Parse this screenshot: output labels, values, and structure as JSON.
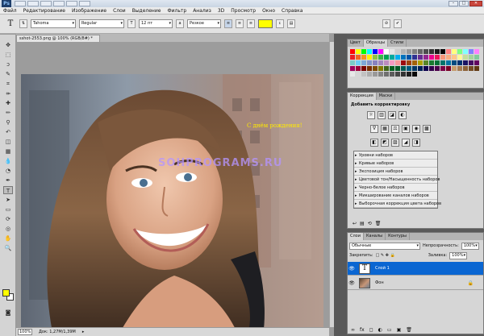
{
  "app": {
    "logo": "Ps"
  },
  "menu": [
    "Файл",
    "Редактирование",
    "Изображение",
    "Слои",
    "Выделение",
    "Фильтр",
    "Анализ",
    "3D",
    "Просмотр",
    "Окно",
    "Справка"
  ],
  "window_controls": {
    "minimize": "–",
    "maximize": "□",
    "close": "✕"
  },
  "options": {
    "tool_glyph": "T",
    "font_family": "Tahoma",
    "font_style": "Regular",
    "font_size": "12 пт",
    "antialias": "Резкое",
    "text_color": "#ffff00",
    "cancel_glyph": "⊘",
    "commit_glyph": "✔"
  },
  "document": {
    "tab": "sshot-2553.png @ 100% (RGB/8#) *",
    "overlay_text": "С днём рождения!",
    "watermark": "SOHPROGRAMS.RU"
  },
  "status": {
    "zoom": "100%",
    "doc": "Док: 1,27M/1,39M"
  },
  "swatches_panel": {
    "tabs": [
      "Цвет",
      "Образцы",
      "Стили"
    ],
    "active_tab": 1,
    "colors": [
      "#ff0000",
      "#ffff00",
      "#00ff00",
      "#00ffff",
      "#0000ff",
      "#ff00ff",
      "#ffffff",
      "#e6e6e6",
      "#cccccc",
      "#b3b3b3",
      "#999999",
      "#808080",
      "#666666",
      "#4d4d4d",
      "#333333",
      "#1a1a1a",
      "#000000",
      "#ff8080",
      "#ffff80",
      "#80ff80",
      "#80ffff",
      "#8080ff",
      "#ff80ff",
      "#ed1c24",
      "#f26522",
      "#f7941d",
      "#fff200",
      "#8dc63f",
      "#39b54a",
      "#00a651",
      "#00a99d",
      "#00aeef",
      "#0072bc",
      "#0054a6",
      "#2e3192",
      "#662d91",
      "#92278f",
      "#ec008c",
      "#ed145b",
      "#f69679",
      "#f9ad81",
      "#fdc68a",
      "#fff799",
      "#c4df9b",
      "#a3d39c",
      "#82ca9c",
      "#7accc8",
      "#6dcff6",
      "#7da7d9",
      "#8393ca",
      "#8781bd",
      "#a186be",
      "#bd8cbf",
      "#f49ac2",
      "#f6989d",
      "#9e0b0f",
      "#a0410d",
      "#a36209",
      "#aba000",
      "#598527",
      "#1a7b30",
      "#007236",
      "#00746b",
      "#0076a3",
      "#004b80",
      "#003471",
      "#1b1464",
      "#440e62",
      "#630460",
      "#9e005d",
      "#9e0039",
      "#790000",
      "#7b2e00",
      "#7d4900",
      "#827b00",
      "#406618",
      "#005e20",
      "#005826",
      "#005952",
      "#005b7f",
      "#003663",
      "#002157",
      "#0d004c",
      "#32004b",
      "#4b0049",
      "#7b0046",
      "#7a0026",
      "#c69c6d",
      "#a67c52",
      "#8c6239",
      "#754c24",
      "#603913",
      "#e8e8e8",
      "#d6d6d6",
      "#c2c2c2",
      "#adadad",
      "#999999",
      "#858585",
      "#707070",
      "#5c5c5c",
      "#474747",
      "#333333",
      "#1f1f1f",
      "#0a0a0a"
    ]
  },
  "adjustments_panel": {
    "tabs": [
      "Коррекция",
      "Маски"
    ],
    "active_tab": 0,
    "title": "Добавить корректировку",
    "row1_icons": [
      "☼",
      "▥",
      "◪",
      "◐"
    ],
    "row2_icons": [
      "∇",
      "▦",
      "⚖",
      "▣",
      "◉",
      "▩"
    ],
    "row3_icons": [
      "◧",
      "◩",
      "▨",
      "◢",
      "◨"
    ],
    "presets": [
      "Уровни наборов",
      "Кривые наборов",
      "Экспозиция наборов",
      "Цветовой тон/Насыщенность наборов",
      "Черно-белое наборов",
      "Микширование каналов наборов",
      "Выборочная коррекция цвета наборов"
    ],
    "footer_icons": [
      "↩",
      "▤",
      "⟲",
      "🗑"
    ]
  },
  "layers_panel": {
    "tabs": [
      "Слои",
      "Каналы",
      "Контуры"
    ],
    "active_tab": 0,
    "blend_mode": "Обычные",
    "opacity_label": "Непрозрачность:",
    "opacity_value": "100%",
    "lock_label": "Закрепить:",
    "fill_label": "Заливка:",
    "fill_value": "100%",
    "layers": [
      {
        "name": "Слой 1",
        "thumb": "T",
        "selected": true
      },
      {
        "name": "Фон",
        "thumb": "",
        "selected": false
      }
    ],
    "eye_glyph": "👁",
    "lock_glyph": "🔒",
    "footer_icons": [
      "∞",
      "fx",
      "◻",
      "◐",
      "▭",
      "▣",
      "🗑"
    ]
  }
}
